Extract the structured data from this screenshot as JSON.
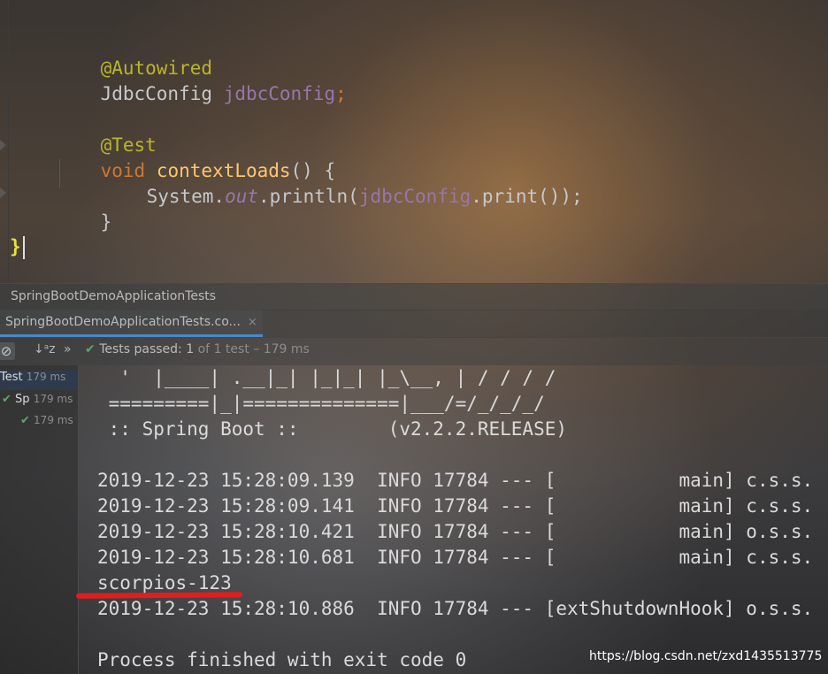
{
  "editor": {
    "line1": "@Autowired",
    "line2_type": "JdbcConfig",
    "line2_field": "jdbcConfig",
    "line2_semi": ";",
    "line4": "@Test",
    "line5_kw": "void",
    "line5_method": "contextLoads",
    "line5_rest": "() {",
    "line6_system": "System.",
    "line6_out": "out",
    "line6_println": ".println(",
    "line6_field": "jdbcConfig",
    "line6_print": ".print());",
    "line6_semi": "",
    "line7": "}",
    "line9": "}"
  },
  "run_panel": {
    "title": "SpringBootDemoApplicationTests",
    "tab_label": "SpringBootDemoApplicationTests.co...",
    "tab_close": "×",
    "stop_icon": "⊘",
    "sort_icon": "↓ᵃz",
    "more_icon": "»",
    "status_check": "✔",
    "status_prefix": "Tests passed:",
    "status_passed": "1",
    "status_of": "of",
    "status_total": "1 test",
    "status_time": "– 179 ms"
  },
  "test_tree": [
    {
      "name": "Test",
      "time": "179 ms"
    },
    {
      "name": "Sp",
      "time": "179 ms"
    },
    {
      "name": "",
      "time": "179 ms"
    }
  ],
  "console": {
    "banner1": "  '  |____| .__|_| |_|_| |_\\__, | / / / /",
    "banner2": " =========|_|==============|___/=/_/_/_/",
    "banner3": " :: Spring Boot ::        (v2.2.2.RELEASE)",
    "log1": "2019-12-23 15:28:09.139  INFO 17784 --- [           main] c.s.s.",
    "log2": "2019-12-23 15:28:09.141  INFO 17784 --- [           main] c.s.s.",
    "log3": "2019-12-23 15:28:10.421  INFO 17784 --- [           main] o.s.s.",
    "log4": "2019-12-23 15:28:10.681  INFO 17784 --- [           main] c.s.s.",
    "output": "scorpios-123",
    "log5": "2019-12-23 15:28:10.886  INFO 17784 --- [extShutdownHook] o.s.s.",
    "exit": "Process finished with exit code 0"
  },
  "watermark": "https://blog.csdn.net/zxd1435513775",
  "colors": {
    "annotation": "#bbb529",
    "keyword": "#cc7832",
    "method": "#ffc66d",
    "field": "#9876aa",
    "pass_green": "#59a869",
    "underline_red": "#e01e1e"
  }
}
